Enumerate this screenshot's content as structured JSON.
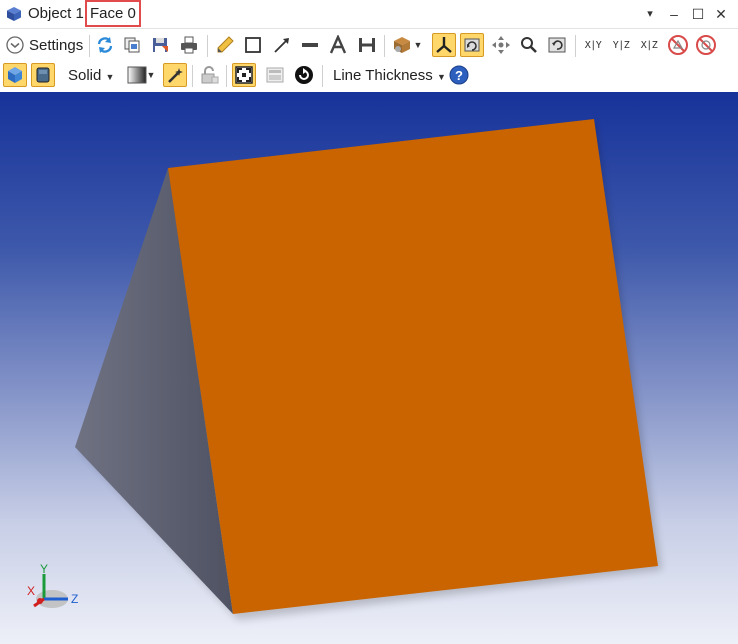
{
  "window": {
    "title_prefix": "Object 1: ",
    "title_face": "Face 0",
    "minimize_label": "▾",
    "restore_label": "–",
    "maximize_label": "☐",
    "close_label": "✕"
  },
  "toolbar1": {
    "settings_label": "Settings",
    "axis_labels": [
      "X|Y",
      "Y|Z",
      "X|Z"
    ]
  },
  "toolbar2": {
    "render_mode": "Solid",
    "line_thickness_label": "Line Thickness"
  },
  "triad": {
    "x_label": "X",
    "y_label": "Y",
    "z_label": "Z"
  },
  "colors": {
    "face_orange": "#c96400",
    "side_gray": "#5b5e6e",
    "accent_active": "#ffd76a",
    "highlight_box": "#e24b4b"
  }
}
